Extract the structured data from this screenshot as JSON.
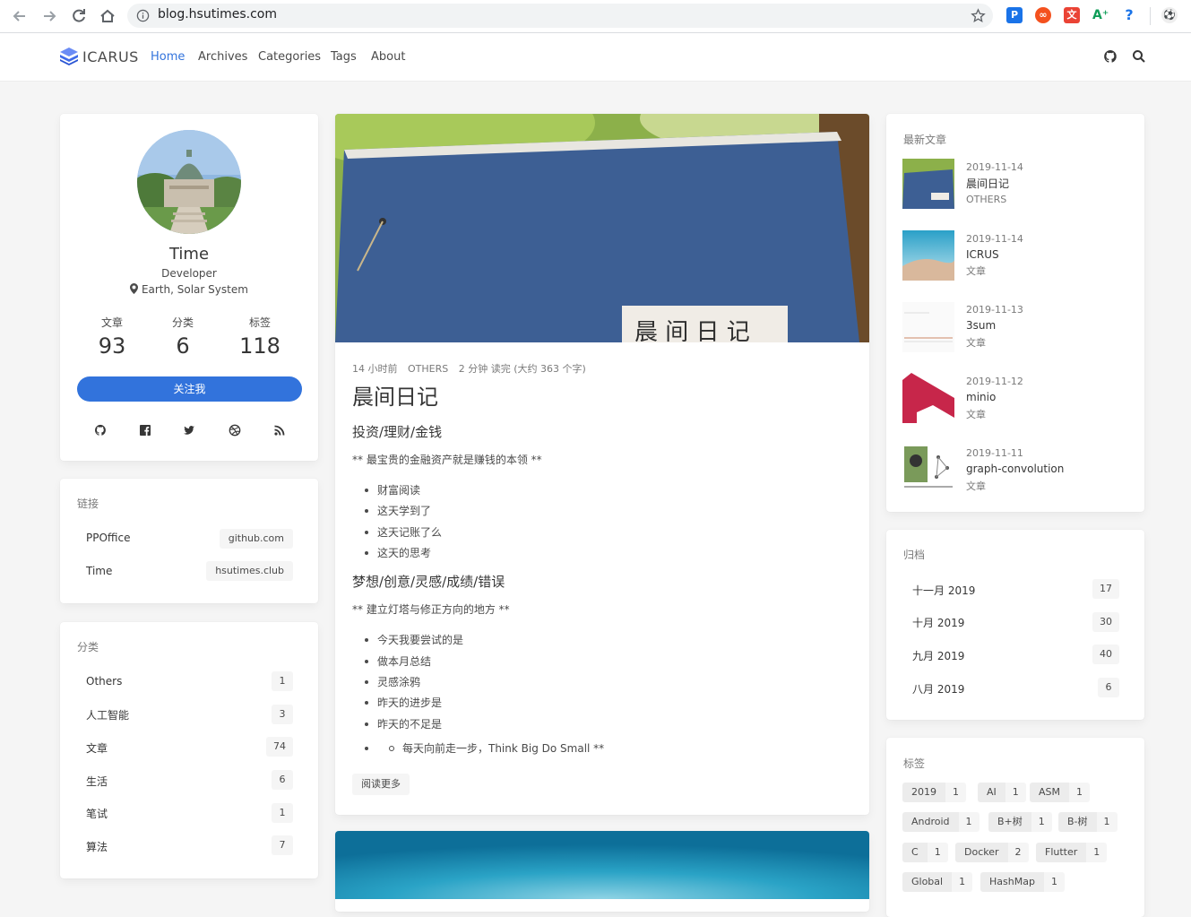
{
  "browser": {
    "url": "blog.hsutimes.com"
  },
  "nav": {
    "brand": "ICARUS",
    "links": [
      "Home",
      "Archives",
      "Categories",
      "Tags",
      "About"
    ]
  },
  "profile": {
    "name": "Time",
    "role": "Developer",
    "location": "Earth, Solar System",
    "stats": [
      {
        "label": "文章",
        "value": "93"
      },
      {
        "label": "分类",
        "value": "6"
      },
      {
        "label": "标签",
        "value": "118"
      }
    ],
    "follow_label": "关注我"
  },
  "links_card": {
    "title": "链接",
    "items": [
      {
        "name": "PPOffice",
        "host": "github.com"
      },
      {
        "name": "Time",
        "host": "hsutimes.club"
      }
    ]
  },
  "categories_card": {
    "title": "分类",
    "items": [
      {
        "name": "Others",
        "count": "1"
      },
      {
        "name": "人工智能",
        "count": "3"
      },
      {
        "name": "文章",
        "count": "74"
      },
      {
        "name": "生活",
        "count": "6"
      },
      {
        "name": "笔试",
        "count": "1"
      },
      {
        "name": "算法",
        "count": "7"
      }
    ]
  },
  "post": {
    "meta_time": "14 小时前",
    "meta_category": "OTHERS",
    "meta_read": "2 分钟 读完 (大约 363 个字)",
    "title": "晨间日记",
    "cover_text": "晨 间 日 记",
    "h1": "投资/理财/金钱",
    "p1": "** 最宝贵的金融资产就是赚钱的本领 **",
    "list1": [
      "财富阅读",
      "这天学到了",
      "这天记账了么",
      "这天的思考"
    ],
    "h2": "梦想/创意/灵感/成绩/错误",
    "p2": "** 建立灯塔与修正方向的地方 **",
    "list2": [
      "今天我要尝试的是",
      "做本月总结",
      "灵感涂鸦",
      "昨天的进步是",
      "昨天的不足是"
    ],
    "nested": "每天向前走一步，Think Big Do Small **",
    "read_more": "阅读更多"
  },
  "recent": {
    "title": "最新文章",
    "items": [
      {
        "date": "2019-11-14",
        "title": "晨间日记",
        "category": "OTHERS"
      },
      {
        "date": "2019-11-14",
        "title": "ICRUS",
        "category": "文章"
      },
      {
        "date": "2019-11-13",
        "title": "3sum",
        "category": "文章"
      },
      {
        "date": "2019-11-12",
        "title": "minio",
        "category": "文章"
      },
      {
        "date": "2019-11-11",
        "title": "graph-convolution",
        "category": "文章"
      }
    ]
  },
  "archives": {
    "title": "归档",
    "items": [
      {
        "month": "十一月 2019",
        "count": "17"
      },
      {
        "month": "十月 2019",
        "count": "30"
      },
      {
        "month": "九月 2019",
        "count": "40"
      },
      {
        "month": "八月 2019",
        "count": "6"
      }
    ]
  },
  "tags": {
    "title": "标签",
    "items": [
      {
        "name": "2019",
        "count": "1"
      },
      {
        "name": "AI",
        "count": "1"
      },
      {
        "name": "ASM",
        "count": "1"
      },
      {
        "name": "Android",
        "count": "1"
      },
      {
        "name": "B+树",
        "count": "1"
      },
      {
        "name": "B-树",
        "count": "1"
      },
      {
        "name": "C",
        "count": "1"
      },
      {
        "name": "Docker",
        "count": "2"
      },
      {
        "name": "Flutter",
        "count": "1"
      },
      {
        "name": "Global",
        "count": "1"
      },
      {
        "name": "HashMap",
        "count": "1"
      }
    ]
  },
  "colors": {
    "accent": "#3273dc",
    "background": "#f5f5f5",
    "card": "#ffffff"
  }
}
